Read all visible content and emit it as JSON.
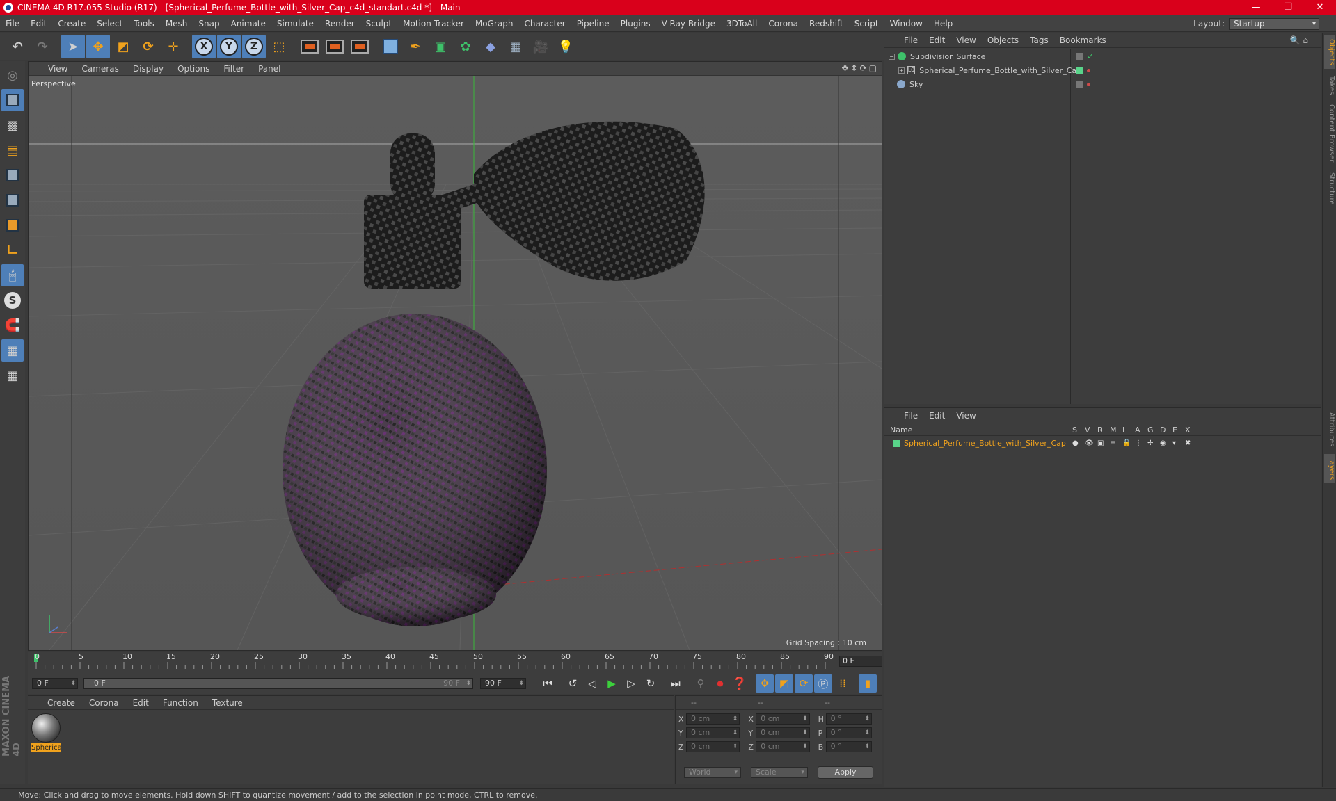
{
  "window": {
    "title": "CINEMA 4D R17.055 Studio (R17) - [Spherical_Perfume_Bottle_with_Silver_Cap_c4d_standart.c4d *] - Main",
    "controls": [
      "—",
      "❐",
      "✕"
    ]
  },
  "menubar": {
    "items": [
      "File",
      "Edit",
      "Create",
      "Select",
      "Tools",
      "Mesh",
      "Snap",
      "Animate",
      "Simulate",
      "Render",
      "Sculpt",
      "Motion Tracker",
      "MoGraph",
      "Character",
      "Pipeline",
      "Plugins",
      "V-Ray Bridge",
      "3DToAll",
      "Corona",
      "Redshift",
      "Script",
      "Window",
      "Help"
    ],
    "layout_label": "Layout:",
    "layout_value": "Startup"
  },
  "toolbar": {
    "axis_x": "X",
    "axis_y": "Y",
    "axis_z": "Z"
  },
  "viewport": {
    "menu": [
      "View",
      "Cameras",
      "Display",
      "Options",
      "Filter",
      "Panel"
    ],
    "label": "Perspective",
    "grid_spacing": "Grid Spacing : 10 cm",
    "nav_icons": "✥⇕⟳▢"
  },
  "timeline": {
    "ticks": [
      "0",
      "5",
      "10",
      "15",
      "20",
      "25",
      "30",
      "35",
      "40",
      "45",
      "50",
      "55",
      "60",
      "65",
      "70",
      "75",
      "80",
      "85",
      "90"
    ],
    "current_frame": "0 F",
    "start_field": "0 F",
    "slider_left": "0 F",
    "slider_right": "90 F",
    "end_field": "90 F"
  },
  "material_manager": {
    "menu": [
      "Create",
      "Corona",
      "Edit",
      "Function",
      "Texture"
    ],
    "material_name": "Spherical"
  },
  "coordinates": {
    "headers": [
      "--",
      "--",
      "--"
    ],
    "rows": [
      {
        "a1": "X",
        "v1": "0 cm",
        "a2": "X",
        "v2": "0 cm",
        "a3": "H",
        "v3": "0 °"
      },
      {
        "a1": "Y",
        "v1": "0 cm",
        "a2": "Y",
        "v2": "0 cm",
        "a3": "P",
        "v3": "0 °"
      },
      {
        "a1": "Z",
        "v1": "0 cm",
        "a2": "Z",
        "v2": "0 cm",
        "a3": "B",
        "v3": "0 °"
      }
    ],
    "space": "World",
    "mode": "Scale",
    "apply": "Apply"
  },
  "object_manager": {
    "menu": [
      "File",
      "Edit",
      "View",
      "Objects",
      "Tags",
      "Bookmarks"
    ],
    "objects": [
      {
        "name": "Subdivision Surface"
      },
      {
        "name": "Spherical_Perfume_Bottle_with_Silver_Cap"
      },
      {
        "name": "Sky"
      }
    ]
  },
  "layer_manager": {
    "menu": [
      "File",
      "Edit",
      "View"
    ],
    "name_header": "Name",
    "columns": [
      "S",
      "V",
      "R",
      "M",
      "L",
      "A",
      "G",
      "D",
      "E",
      "X"
    ],
    "layer_name": "Spherical_Perfume_Bottle_with_Silver_Cap"
  },
  "side_tabs": [
    "Objects",
    "Takes",
    "Content Browser",
    "Structure",
    "Attributes",
    "Layers"
  ],
  "status": "Move: Click and drag to move elements. Hold down SHIFT to quantize movement / add to the selection in point mode, CTRL to remove.",
  "maxon_logo": "MAXON CINEMA 4D",
  "colors": {
    "titlebar": "#d9001b",
    "accent_blue": "#4e7fb8",
    "accent_orange": "#f0a21d",
    "layer_green": "#59d48a"
  }
}
